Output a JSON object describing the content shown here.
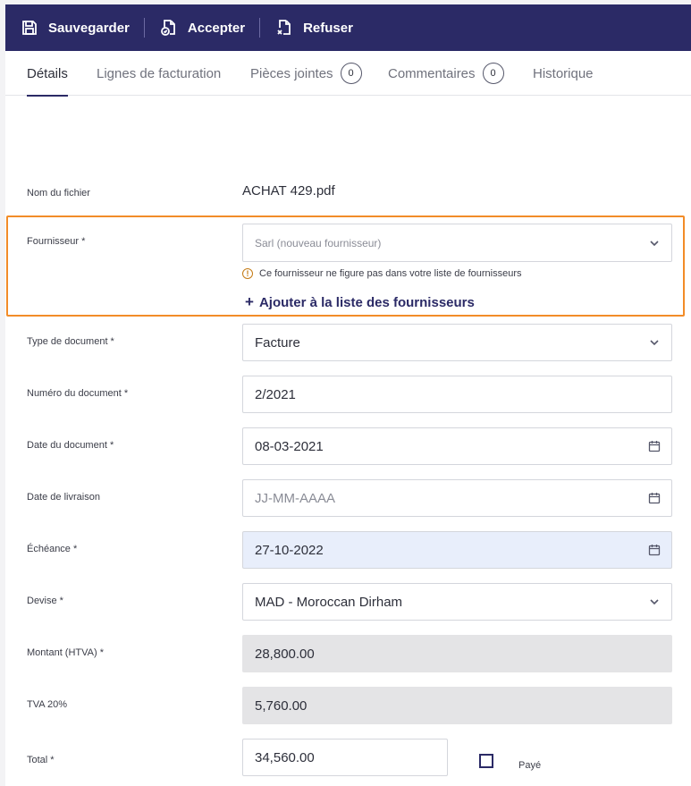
{
  "toolbar": {
    "save_label": "Sauvegarder",
    "accept_label": "Accepter",
    "refuse_label": "Refuser"
  },
  "tabs": [
    {
      "label": "Détails"
    },
    {
      "label": "Lignes de facturation"
    },
    {
      "label": "Pièces jointes",
      "count": "0"
    },
    {
      "label": "Commentaires",
      "count": "0"
    },
    {
      "label": "Historique"
    }
  ],
  "form": {
    "filename_label": "Nom du fichier",
    "filename_value": "ACHAT 429.pdf",
    "supplier_label": "Fournisseur *",
    "supplier_placeholder": "Sarl (nouveau fournisseur)",
    "supplier_warning": "Ce fournisseur ne figure pas dans votre liste de fournisseurs",
    "supplier_add_link": "Ajouter à la liste des fournisseurs",
    "doctype_label": "Type de document *",
    "doctype_value": "Facture",
    "docnumber_label": "Numéro du document *",
    "docnumber_value": "2/2021",
    "docdate_label": "Date du document *",
    "docdate_value": "08-03-2021",
    "delivery_label": "Date de livraison",
    "delivery_placeholder": "JJ-MM-AAAA",
    "due_label": "Échéance *",
    "due_value": "27-10-2022",
    "currency_label": "Devise *",
    "currency_value": "MAD - Moroccan Dirham",
    "amount_label": "Montant (HTVA) *",
    "amount_value": "28,800.00",
    "vat_label": "TVA 20%",
    "vat_value": "5,760.00",
    "total_label": "Total *",
    "total_value": "34,560.00",
    "paid_label": "Payé",
    "paid_checked": false
  },
  "colors": {
    "toolbar_bg": "#2b2a66",
    "highlight_border": "#f28c28",
    "due_field_bg": "#e8eefb",
    "disabled_field_bg": "#e4e4e6"
  }
}
